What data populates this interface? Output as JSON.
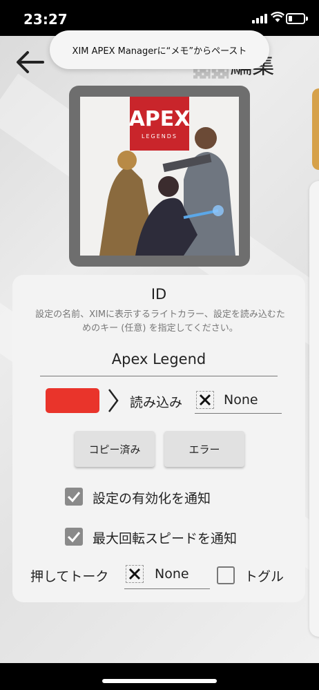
{
  "status": {
    "time": "23:27"
  },
  "toast": {
    "text": "XIM APEX Managerに“メモ”からペースト"
  },
  "header": {
    "title_partial": "編集"
  },
  "card": {
    "title": "ID",
    "description": "設定の名前、XIMに表示するライトカラー、設定を読み込むためのキー (任意) を指定してください。",
    "name_value": "Apex Legend",
    "color_hex": "#e9342b",
    "load_label": "読み込み",
    "load_key": "None",
    "copy_button": "コピー済み",
    "error_button": "エラー",
    "notify_enable_label": "設定の有効化を通知",
    "notify_enable_checked": true,
    "notify_maxspeed_label": "最大回転スピードを通知",
    "notify_maxspeed_checked": true,
    "ptt_label": "押してトーク",
    "ptt_key": "None",
    "toggle_label": "トグル",
    "toggle_checked": false
  },
  "art": {
    "logo_main": "APEX",
    "logo_sub": "LEGENDS"
  },
  "colors": {
    "accent_tab": "#d6a14a",
    "logo_red": "#c9252b"
  }
}
